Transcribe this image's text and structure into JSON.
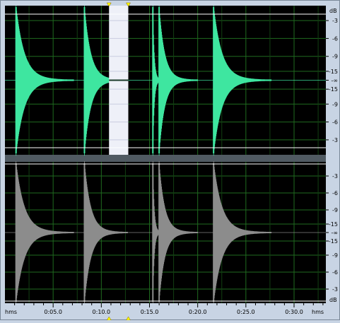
{
  "colors": {
    "frame": "#c8d4e4",
    "plot_bg": "#000000",
    "grid": "#1f6a1f",
    "left_wave": "#3ee6a0",
    "right_wave": "#8c8c8c",
    "clip_line": "#ffffff",
    "selection": "#eef0f8",
    "marker": "#ffff00"
  },
  "amplitude_ruler": {
    "unit_label": "dB",
    "top_channel_labels": [
      "-3",
      "-6",
      "-9",
      "-15",
      "-∞",
      "-15",
      "-9",
      "-6",
      "-3"
    ],
    "bottom_channel_labels": [
      "-3",
      "-6",
      "-9",
      "-15",
      "-∞",
      "-15",
      "-9",
      "-6",
      "-3"
    ]
  },
  "time_ruler": {
    "format_label": "hms",
    "range_seconds": [
      0,
      33.3
    ],
    "ticks": [
      {
        "t": 5,
        "label": "0:05.0"
      },
      {
        "t": 10,
        "label": "0:10.0"
      },
      {
        "t": 15,
        "label": "0:15.0"
      },
      {
        "t": 20,
        "label": "0:20.0"
      },
      {
        "t": 25,
        "label": "0:25.0"
      },
      {
        "t": 30,
        "label": "0:30.0"
      }
    ]
  },
  "selection": {
    "start_seconds": 10.8,
    "end_seconds": 12.8
  },
  "channels": [
    {
      "id": "left",
      "impulses": [
        {
          "t": 1.15,
          "decay": 6.0
        },
        {
          "t": 8.25,
          "decay": 4.5
        },
        {
          "t": 15.35,
          "decay": 1.0
        },
        {
          "t": 16.0,
          "decay": 4.0
        },
        {
          "t": 21.65,
          "decay": 6.0
        }
      ]
    },
    {
      "id": "right",
      "impulses": [
        {
          "t": 1.15,
          "decay": 6.0
        },
        {
          "t": 8.25,
          "decay": 4.5
        },
        {
          "t": 15.35,
          "decay": 1.0
        },
        {
          "t": 16.0,
          "decay": 4.0
        },
        {
          "t": 21.65,
          "decay": 6.0
        }
      ]
    }
  ]
}
